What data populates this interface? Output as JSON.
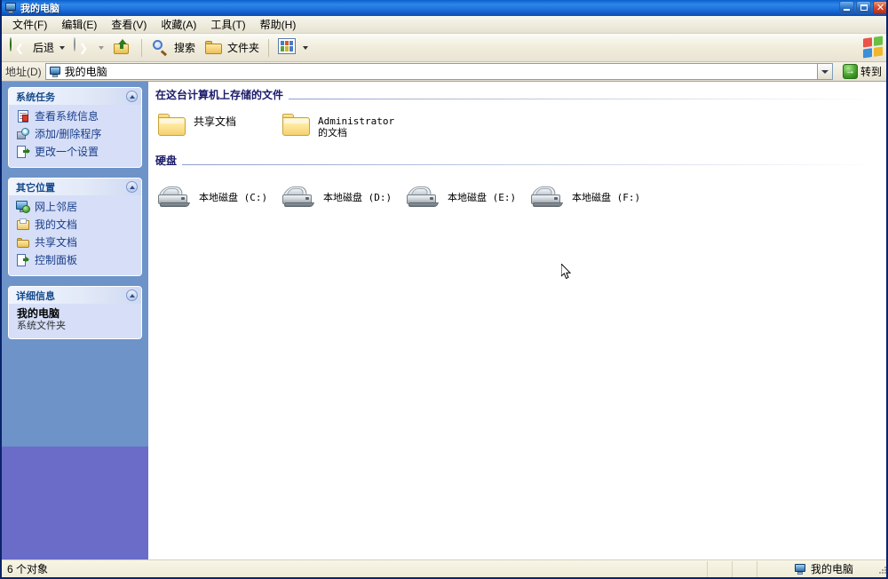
{
  "window": {
    "title": "我的电脑",
    "title_icon": "my-computer-icon",
    "buttons": {
      "minimize": "minimize-button",
      "maximize": "maximize-button",
      "close": "close-button"
    }
  },
  "menubar": {
    "items": [
      {
        "label": "文件(F)"
      },
      {
        "label": "编辑(E)"
      },
      {
        "label": "查看(V)"
      },
      {
        "label": "收藏(A)"
      },
      {
        "label": "工具(T)"
      },
      {
        "label": "帮助(H)"
      }
    ]
  },
  "toolbar": {
    "back_label": "后退",
    "forward_label": "",
    "up_label": "",
    "search_label": "搜索",
    "folders_label": "文件夹",
    "views_label": ""
  },
  "addressbar": {
    "label": "地址(D)",
    "value": "我的电脑",
    "go_label": "转到",
    "go_arrow": "→"
  },
  "sidebar": {
    "panels": [
      {
        "title": "系统任务",
        "items": [
          {
            "label": "查看系统信息",
            "icon": "system-info-icon"
          },
          {
            "label": "添加/删除程序",
            "icon": "add-remove-programs-icon"
          },
          {
            "label": "更改一个设置",
            "icon": "change-setting-icon"
          }
        ]
      },
      {
        "title": "其它位置",
        "items": [
          {
            "label": "网上邻居",
            "icon": "network-places-icon"
          },
          {
            "label": "我的文档",
            "icon": "my-documents-icon"
          },
          {
            "label": "共享文档",
            "icon": "shared-documents-icon"
          },
          {
            "label": "控制面板",
            "icon": "control-panel-icon"
          }
        ]
      },
      {
        "title": "详细信息",
        "detail_title": "我的电脑",
        "detail_subtitle": "系统文件夹"
      }
    ]
  },
  "main": {
    "groups": [
      {
        "title": "在这台计算机上存储的文件",
        "items": [
          {
            "label": "共享文档",
            "icon": "folder-icon"
          },
          {
            "label": "Administrator 的文档",
            "icon": "folder-icon"
          }
        ]
      },
      {
        "title": "硬盘",
        "items": [
          {
            "label": "本地磁盘 (C:)",
            "icon": "hard-drive-icon"
          },
          {
            "label": "本地磁盘 (D:)",
            "icon": "hard-drive-icon"
          },
          {
            "label": "本地磁盘 (E:)",
            "icon": "hard-drive-icon"
          },
          {
            "label": "本地磁盘 (F:)",
            "icon": "hard-drive-icon"
          }
        ]
      }
    ]
  },
  "statusbar": {
    "object_count": "6 个对象",
    "location": "我的电脑"
  },
  "colors": {
    "titlebar_blue": "#1e74dd",
    "sidebar_blue": "#6d93c9",
    "sidebar_purple": "#6a6cc8",
    "panel_body": "#d6dff7",
    "panel_title_text": "#13498b",
    "group_title_text": "#1b1b6b",
    "chrome_beige": "#ece9d8"
  }
}
